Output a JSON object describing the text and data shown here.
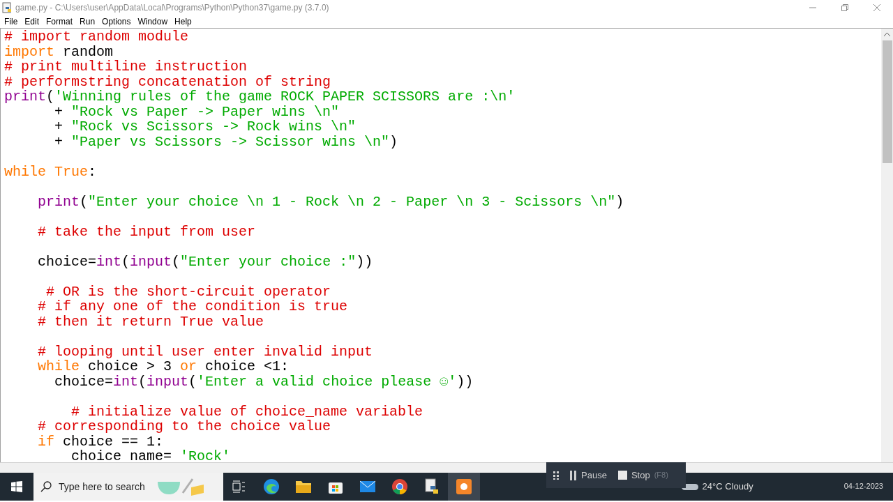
{
  "window": {
    "title": "game.py - C:\\Users\\user\\AppData\\Local\\Programs\\Python\\Python37\\game.py (3.7.0)"
  },
  "menu": [
    "File",
    "Edit",
    "Format",
    "Run",
    "Options",
    "Window",
    "Help"
  ],
  "code": [
    {
      "kind": "code",
      "segments": [
        {
          "kind": "comment",
          "text": "# import random module"
        }
      ]
    },
    {
      "kind": "code",
      "segments": [
        {
          "kind": "keyword",
          "text": "import"
        },
        {
          "kind": "plain",
          "text": " random"
        }
      ]
    },
    {
      "kind": "code",
      "segments": [
        {
          "kind": "comment",
          "text": "# print multiline instruction"
        }
      ]
    },
    {
      "kind": "code",
      "segments": [
        {
          "kind": "comment",
          "text": "# performstring concatenation of string"
        }
      ]
    },
    {
      "kind": "code",
      "segments": [
        {
          "kind": "builtin",
          "text": "print"
        },
        {
          "kind": "plain",
          "text": "("
        },
        {
          "kind": "string",
          "text": "'Winning rules of the game ROCK PAPER SCISSORS are :\\n'"
        }
      ]
    },
    {
      "kind": "code",
      "segments": [
        {
          "kind": "plain",
          "text": "      + "
        },
        {
          "kind": "string",
          "text": "\"Rock vs Paper -> Paper wins \\n\""
        }
      ]
    },
    {
      "kind": "code",
      "segments": [
        {
          "kind": "plain",
          "text": "      + "
        },
        {
          "kind": "string",
          "text": "\"Rock vs Scissors -> Rock wins \\n\""
        }
      ]
    },
    {
      "kind": "code",
      "segments": [
        {
          "kind": "plain",
          "text": "      + "
        },
        {
          "kind": "string",
          "text": "\"Paper vs Scissors -> Scissor wins \\n\""
        },
        {
          "kind": "plain",
          "text": ")"
        }
      ]
    },
    {
      "kind": "blank"
    },
    {
      "kind": "code",
      "segments": [
        {
          "kind": "keyword",
          "text": "while True"
        },
        {
          "kind": "plain",
          "text": ":"
        }
      ]
    },
    {
      "kind": "blank"
    },
    {
      "kind": "code",
      "segments": [
        {
          "kind": "builtin",
          "text": "    print"
        },
        {
          "kind": "plain",
          "text": "("
        },
        {
          "kind": "string",
          "text": "\"Enter your choice \\n 1 - Rock \\n 2 - Paper \\n 3 - Scissors \\n\""
        },
        {
          "kind": "plain",
          "text": ")"
        }
      ]
    },
    {
      "kind": "blank"
    },
    {
      "kind": "code",
      "segments": [
        {
          "kind": "comment",
          "text": "    # take the input from user"
        }
      ]
    },
    {
      "kind": "blank"
    },
    {
      "kind": "code",
      "segments": [
        {
          "kind": "plain",
          "text": "    choice="
        },
        {
          "kind": "builtin",
          "text": "int"
        },
        {
          "kind": "plain",
          "text": "("
        },
        {
          "kind": "builtin",
          "text": "input"
        },
        {
          "kind": "plain",
          "text": "("
        },
        {
          "kind": "string",
          "text": "\"Enter your choice :\""
        },
        {
          "kind": "plain",
          "text": "))"
        }
      ]
    },
    {
      "kind": "blank"
    },
    {
      "kind": "code",
      "segments": [
        {
          "kind": "comment",
          "text": "     # OR is the short-circuit operator"
        }
      ]
    },
    {
      "kind": "code",
      "segments": [
        {
          "kind": "comment",
          "text": "    # if any one of the condition is true"
        }
      ]
    },
    {
      "kind": "code",
      "segments": [
        {
          "kind": "comment",
          "text": "    # then it return True value"
        }
      ]
    },
    {
      "kind": "blank"
    },
    {
      "kind": "code",
      "segments": [
        {
          "kind": "comment",
          "text": "    # looping until user enter invalid input"
        }
      ]
    },
    {
      "kind": "code",
      "segments": [
        {
          "kind": "keyword",
          "text": "    while"
        },
        {
          "kind": "plain",
          "text": " choice > 3 "
        },
        {
          "kind": "keyword",
          "text": "or"
        },
        {
          "kind": "plain",
          "text": " choice <1:"
        }
      ]
    },
    {
      "kind": "code",
      "segments": [
        {
          "kind": "plain",
          "text": "      choice="
        },
        {
          "kind": "builtin",
          "text": "int"
        },
        {
          "kind": "plain",
          "text": "("
        },
        {
          "kind": "builtin",
          "text": "input"
        },
        {
          "kind": "plain",
          "text": "("
        },
        {
          "kind": "string",
          "text": "'Enter a valid choice please ☺'"
        },
        {
          "kind": "plain",
          "text": "))"
        }
      ]
    },
    {
      "kind": "blank"
    },
    {
      "kind": "code",
      "segments": [
        {
          "kind": "comment",
          "text": "        # initialize value of choice_name variable"
        }
      ]
    },
    {
      "kind": "code",
      "segments": [
        {
          "kind": "comment",
          "text": "    # corresponding to the choice value"
        }
      ]
    },
    {
      "kind": "code",
      "segments": [
        {
          "kind": "keyword",
          "text": "    if"
        },
        {
          "kind": "plain",
          "text": " choice == 1:"
        }
      ]
    },
    {
      "kind": "code",
      "segments": [
        {
          "kind": "plain",
          "text": "        choice name= "
        },
        {
          "kind": "string",
          "text": "'Rock'"
        }
      ]
    }
  ],
  "recorder": {
    "buttons": [
      {
        "kind": "pause",
        "label": "Pause"
      },
      {
        "kind": "stop",
        "label": "Stop",
        "shortcut": "(F8)"
      }
    ]
  },
  "taskbar": {
    "search_placeholder": "Type here to search",
    "weather": "24°C Cloudy",
    "date": "04-12-2023"
  }
}
